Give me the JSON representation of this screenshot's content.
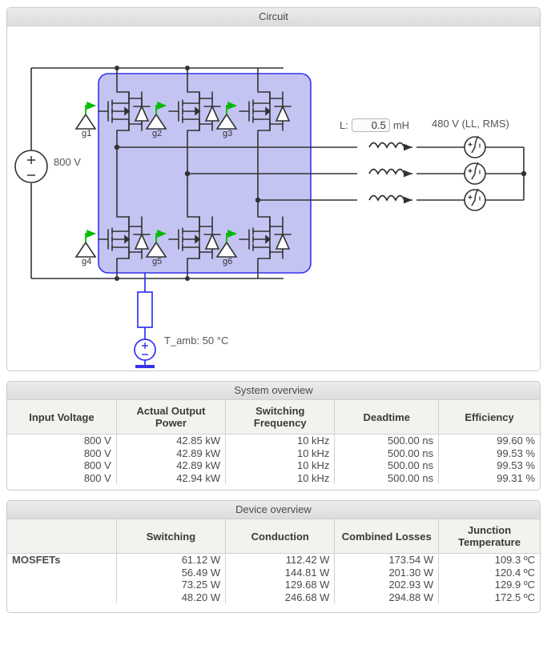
{
  "circuit": {
    "panel_title": "Circuit",
    "dc_source_label": "800 V",
    "inductor_label": "L:",
    "inductor_value": "0.5",
    "inductor_unit": "mH",
    "grid_label": "480 V (LL, RMS)",
    "ambient_label": "T_amb: 50 °C",
    "gates": [
      "g1",
      "g2",
      "g3",
      "g4",
      "g5",
      "g6"
    ],
    "colors": {
      "bridge_fill": "#c4c4f2",
      "bridge_stroke": "#3333ee",
      "wire": "#333333",
      "gate_arrow": "#00bb00",
      "thermal": "#3333ee"
    }
  },
  "system_overview": {
    "panel_title": "System overview",
    "columns": [
      "Input Voltage",
      "Actual Output Power",
      "Switching Frequency",
      "Deadtime",
      "Efficiency"
    ],
    "rows": [
      [
        "800 V",
        "42.85 kW",
        "10 kHz",
        "500.00 ns",
        "99.60 %"
      ],
      [
        "800 V",
        "42.89 kW",
        "10 kHz",
        "500.00 ns",
        "99.53 %"
      ],
      [
        "800 V",
        "42.89 kW",
        "10 kHz",
        "500.00 ns",
        "99.53 %"
      ],
      [
        "800 V",
        "42.94 kW",
        "10 kHz",
        "500.00 ns",
        "99.31 %"
      ]
    ]
  },
  "device_overview": {
    "panel_title": "Device overview",
    "columns": [
      "",
      "Switching",
      "Conduction",
      "Combined Losses",
      "Junction Temperature"
    ],
    "row_label": "MOSFETs",
    "rows": [
      [
        "61.12 W",
        "112.42 W",
        "173.54 W",
        "109.3 ºC"
      ],
      [
        "56.49 W",
        "144.81 W",
        "201.30 W",
        "120.4 ºC"
      ],
      [
        "73.25 W",
        "129.68 W",
        "202.93 W",
        "129.9 ºC"
      ],
      [
        "48.20 W",
        "246.68 W",
        "294.88 W",
        "172.5 ºC"
      ]
    ]
  }
}
